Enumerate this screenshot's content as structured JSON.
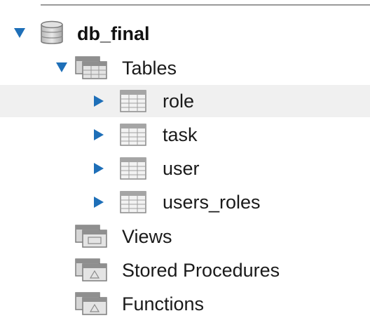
{
  "tree": {
    "schema": {
      "name": "db_final",
      "expanded": true,
      "icon": "database-icon"
    },
    "tables_folder": {
      "label": "Tables",
      "expanded": true,
      "icon": "tables-folder-icon"
    },
    "tables": [
      {
        "name": "role",
        "selected": true,
        "icon": "table-icon"
      },
      {
        "name": "task",
        "selected": false,
        "icon": "table-icon"
      },
      {
        "name": "user",
        "selected": false,
        "icon": "table-icon"
      },
      {
        "name": "users_roles",
        "selected": false,
        "icon": "table-icon"
      }
    ],
    "other_folders": [
      {
        "label": "Views",
        "icon": "views-folder-icon"
      },
      {
        "label": "Stored Procedures",
        "icon": "procedures-folder-icon"
      },
      {
        "label": "Functions",
        "icon": "functions-folder-icon"
      }
    ]
  },
  "colors": {
    "arrow": "#1e6fb8",
    "selection": "#f0f0f0"
  }
}
